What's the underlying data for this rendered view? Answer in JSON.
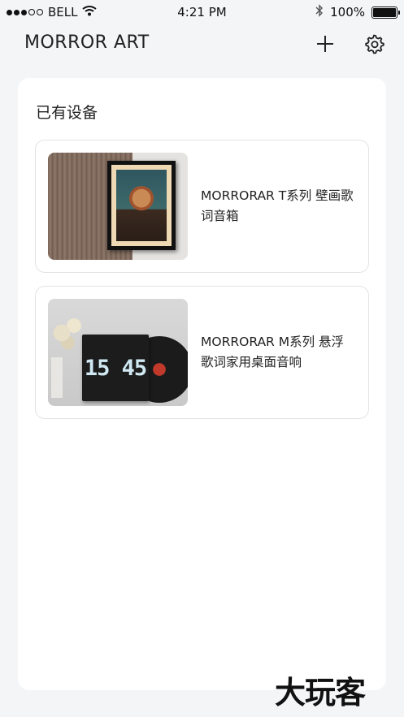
{
  "status_bar": {
    "carrier": "BELL",
    "time": "4:21 PM",
    "battery": "100%"
  },
  "header": {
    "title": "MORROR ART",
    "add_icon": "plus-icon",
    "settings_icon": "gear-icon"
  },
  "devices_section": {
    "title": "已有设备",
    "items": [
      {
        "name": "MORRORAR T系列 壁画歌词音箱",
        "image": "framed-portrait-on-wood-wall"
      },
      {
        "name": "MORRORAR M系列 悬浮歌词家用桌面音响",
        "image": "clock-speaker-with-record",
        "image_text": "15 45"
      }
    ]
  },
  "watermark": "大玩客"
}
